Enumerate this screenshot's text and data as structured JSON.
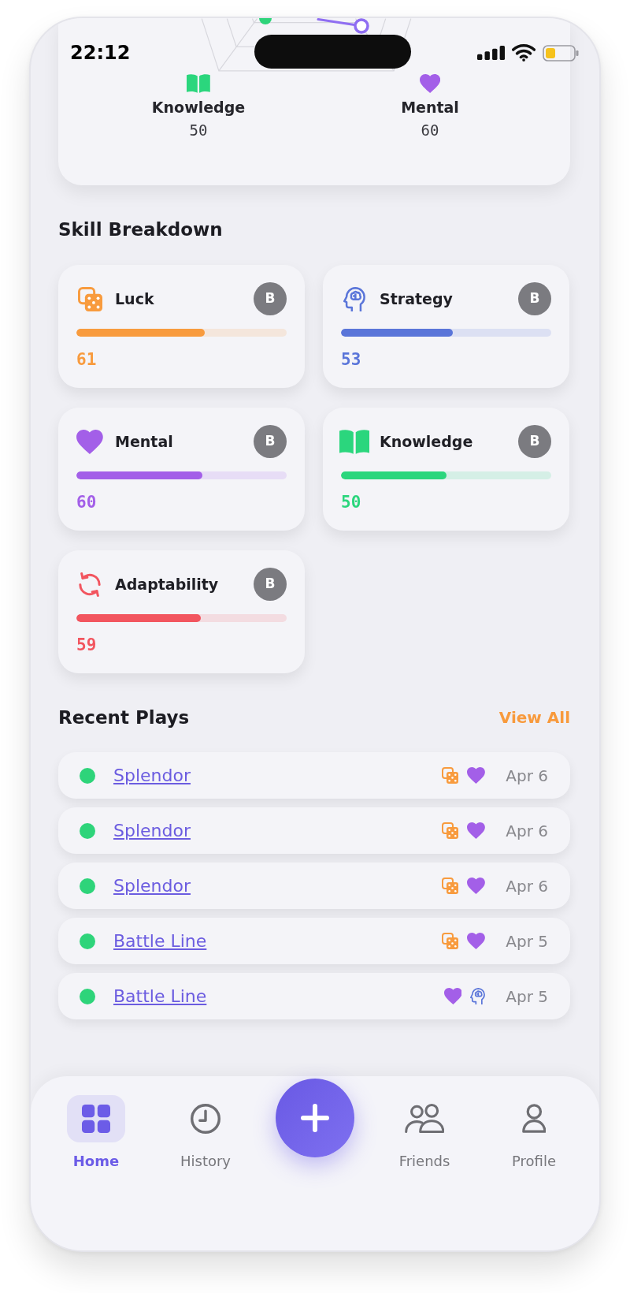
{
  "status_bar": {
    "time": "22:12"
  },
  "radar_card": {
    "axes": [
      {
        "kind": "knowledge",
        "label": "Knowledge",
        "value": "50"
      },
      {
        "kind": "mental",
        "label": "Mental",
        "value": "60"
      }
    ]
  },
  "skill_breakdown": {
    "title": "Skill Breakdown",
    "skills": [
      {
        "kind": "luck",
        "name": "Luck",
        "grade": "B",
        "level": 0.61,
        "score": "61",
        "color": "#f89b3e"
      },
      {
        "kind": "strategy",
        "name": "Strategy",
        "grade": "B",
        "level": 0.53,
        "score": "53",
        "color": "#5a75d9"
      },
      {
        "kind": "mental",
        "name": "Mental",
        "grade": "B",
        "level": 0.6,
        "score": "60",
        "color": "#a35fe8"
      },
      {
        "kind": "knowledge",
        "name": "Knowledge",
        "grade": "B",
        "level": 0.5,
        "score": "50",
        "color": "#2bd67d"
      },
      {
        "kind": "adaptability",
        "name": "Adaptability",
        "grade": "B",
        "level": 0.59,
        "score": "59",
        "color": "#f2555f"
      }
    ]
  },
  "recent_plays": {
    "title": "Recent Plays",
    "view_all": "View All",
    "plays": [
      {
        "color": "#2ed47a",
        "game": "Splendor",
        "tags": [
          {
            "kind": "luck"
          },
          {
            "kind": "mental"
          }
        ],
        "date": "Apr 6"
      },
      {
        "color": "#2ed47a",
        "game": "Splendor",
        "tags": [
          {
            "kind": "luck"
          },
          {
            "kind": "mental"
          }
        ],
        "date": "Apr 6"
      },
      {
        "color": "#2ed47a",
        "game": "Splendor",
        "tags": [
          {
            "kind": "luck"
          },
          {
            "kind": "mental"
          }
        ],
        "date": "Apr 6"
      },
      {
        "color": "#2ed47a",
        "game": "Battle Line",
        "tags": [
          {
            "kind": "luck"
          },
          {
            "kind": "mental"
          }
        ],
        "date": "Apr 5"
      },
      {
        "color": "#2ed47a",
        "game": "Battle Line",
        "tags": [
          {
            "kind": "mental"
          },
          {
            "kind": "strategy"
          }
        ],
        "date": "Apr 5"
      }
    ]
  },
  "nav": {
    "items": [
      {
        "kind": "home",
        "label": "Home",
        "selected": true
      },
      {
        "kind": "history",
        "label": "History",
        "selected": false
      },
      {
        "kind": "add",
        "selected": false
      },
      {
        "kind": "friends",
        "label": "Friends",
        "selected": false
      },
      {
        "kind": "profile",
        "label": "Profile",
        "selected": false
      }
    ]
  }
}
